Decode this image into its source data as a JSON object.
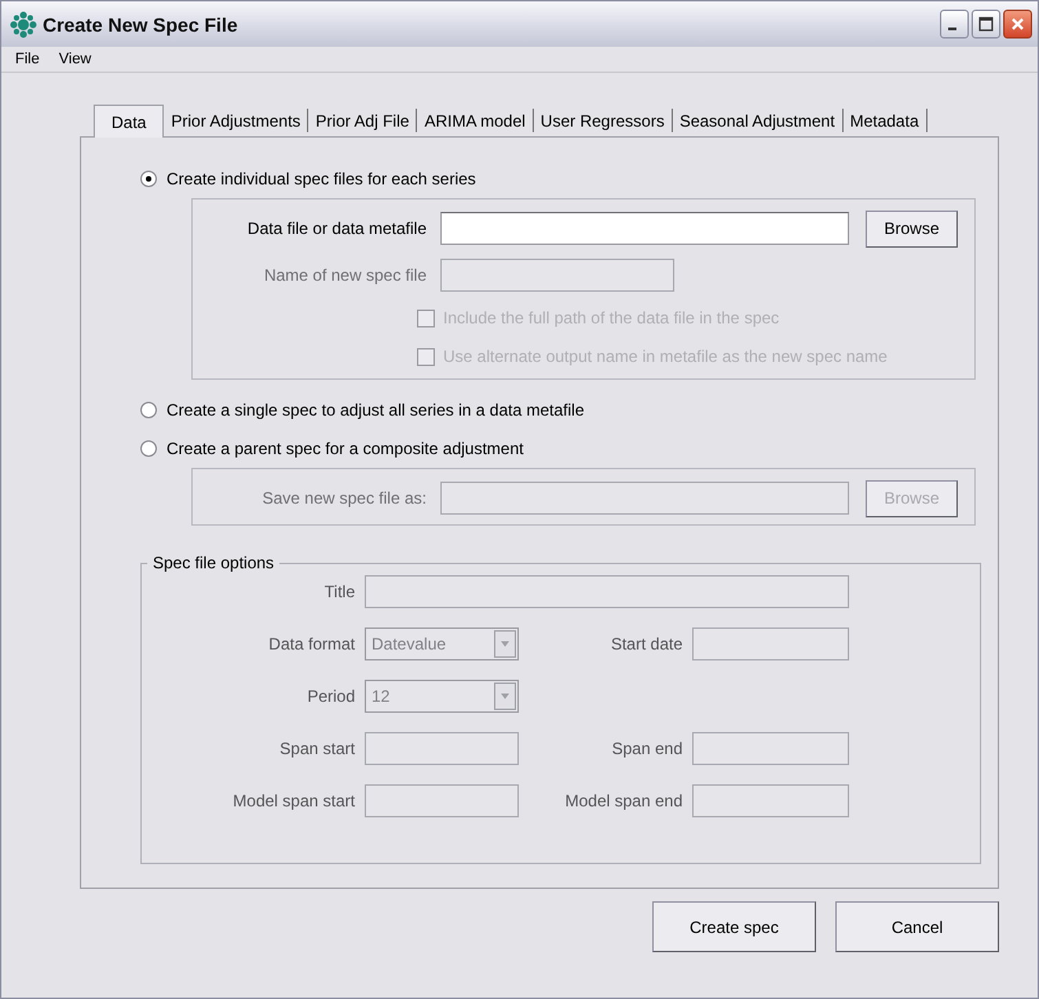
{
  "window": {
    "title": "Create New Spec File"
  },
  "menu": [
    "File",
    "View"
  ],
  "tabs": [
    {
      "label": "Data",
      "selected": true
    },
    {
      "label": "Prior Adjustments",
      "selected": false
    },
    {
      "label": "Prior Adj File",
      "selected": false
    },
    {
      "label": "ARIMA model",
      "selected": false
    },
    {
      "label": "User Regressors",
      "selected": false
    },
    {
      "label": "Seasonal Adjustment",
      "selected": false
    },
    {
      "label": "Metadata",
      "selected": false
    }
  ],
  "modes": [
    {
      "label": "Create individual spec files for each series",
      "selected": true,
      "group": [
        {
          "kind": "file",
          "label": "Data file or data metafile",
          "disabled": false,
          "button": "Browse"
        },
        {
          "kind": "text",
          "label": "Name of new spec file",
          "disabled": true
        },
        {
          "kind": "checkbox",
          "label": "Include the full path of the data file in the spec",
          "checked": false,
          "disabled": true
        },
        {
          "kind": "checkbox",
          "label": "Use alternate output name in metafile as the new spec name",
          "checked": false,
          "disabled": true
        }
      ]
    },
    {
      "label": "Create a single spec to adjust all series in a data metafile",
      "selected": false
    },
    {
      "label": "Create a parent spec for a composite adjustment",
      "selected": false,
      "group": [
        {
          "kind": "file",
          "label": "Save new spec file as:",
          "disabled": true,
          "button": "Browse"
        }
      ]
    }
  ],
  "spec_options": {
    "title": "Spec file options",
    "rows": [
      [
        {
          "kind": "text",
          "label": "Title",
          "disabled": true
        }
      ],
      [
        {
          "kind": "select",
          "label": "Data format",
          "value": "Datevalue",
          "disabled": true
        },
        {
          "kind": "text",
          "label": "Start date",
          "disabled": true
        }
      ],
      [
        {
          "kind": "select",
          "label": "Period",
          "value": "12",
          "disabled": true
        }
      ],
      [
        {
          "kind": "text",
          "label": "Span start",
          "disabled": true
        },
        {
          "kind": "text",
          "label": "Span end",
          "disabled": true
        }
      ],
      [
        {
          "kind": "text",
          "label": "Model span start",
          "disabled": true
        },
        {
          "kind": "text",
          "label": "Model span end",
          "disabled": true
        }
      ]
    ]
  },
  "buttons": [
    "Create spec",
    "Cancel"
  ]
}
